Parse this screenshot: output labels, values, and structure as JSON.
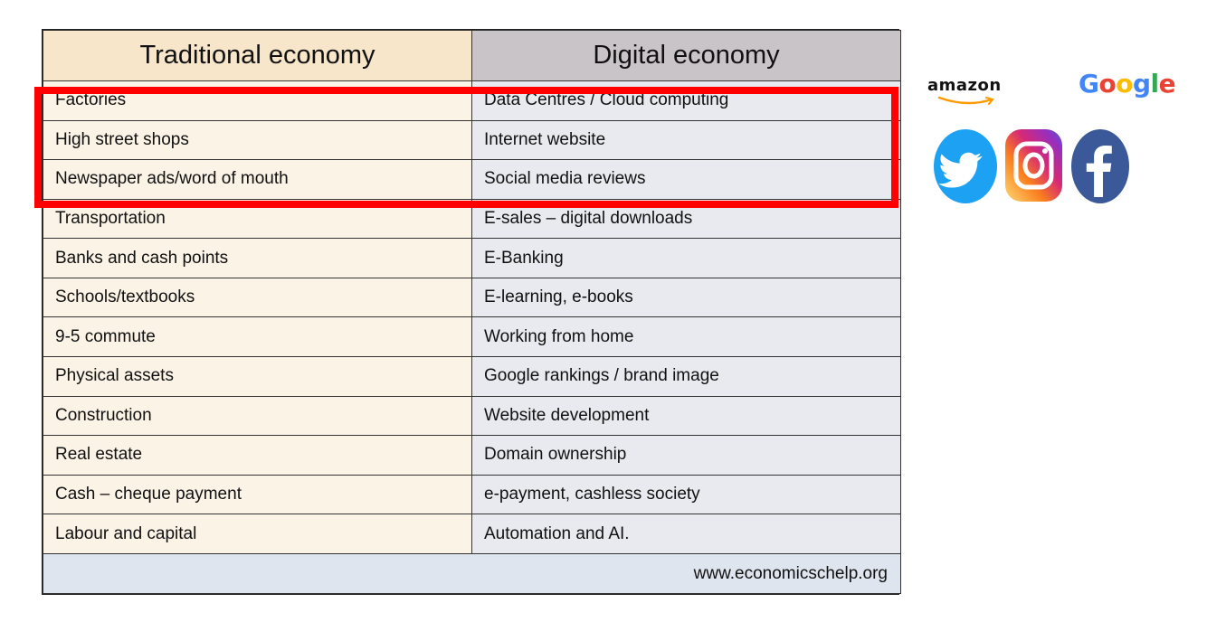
{
  "table": {
    "headers": [
      "Traditional economy",
      "Digital economy"
    ],
    "rows": [
      [
        "Factories",
        "Data Centres / Cloud computing"
      ],
      [
        "High street shops",
        "Internet website"
      ],
      [
        "Newspaper ads/word of mouth",
        "Social media reviews"
      ],
      [
        "Transportation",
        "E-sales – digital downloads"
      ],
      [
        "Banks and cash points",
        "E-Banking"
      ],
      [
        "Schools/textbooks",
        "E-learning, e-books"
      ],
      [
        "9-5 commute",
        "Working from home"
      ],
      [
        "Physical assets",
        "Google rankings / brand image"
      ],
      [
        "Construction",
        "Website development"
      ],
      [
        "Real estate",
        "Domain ownership"
      ],
      [
        "Cash – cheque payment",
        "e-payment, cashless society"
      ],
      [
        "Labour and capital",
        "Automation and AI."
      ]
    ],
    "footer": "www.economicschelp.org"
  },
  "logos": {
    "amazon": "amazon",
    "google": [
      "G",
      "o",
      "o",
      "g",
      "l",
      "e"
    ]
  },
  "colors": {
    "left_header_bg": "#f8e6cb",
    "right_header_bg": "#c9c4c8",
    "left_cell_bg": "#fbf3e6",
    "right_cell_bg": "#e8eaef",
    "footer_bg": "#dfe5ee",
    "highlight": "#ff0000",
    "google": [
      "#4285f4",
      "#ea4335",
      "#fbbc05",
      "#4285f4",
      "#34a853",
      "#ea4335"
    ],
    "twitter": "#1da1f2",
    "facebook": "#3b5998"
  },
  "icons": [
    "amazon-logo",
    "google-logo",
    "twitter-icon",
    "instagram-icon",
    "facebook-icon"
  ]
}
